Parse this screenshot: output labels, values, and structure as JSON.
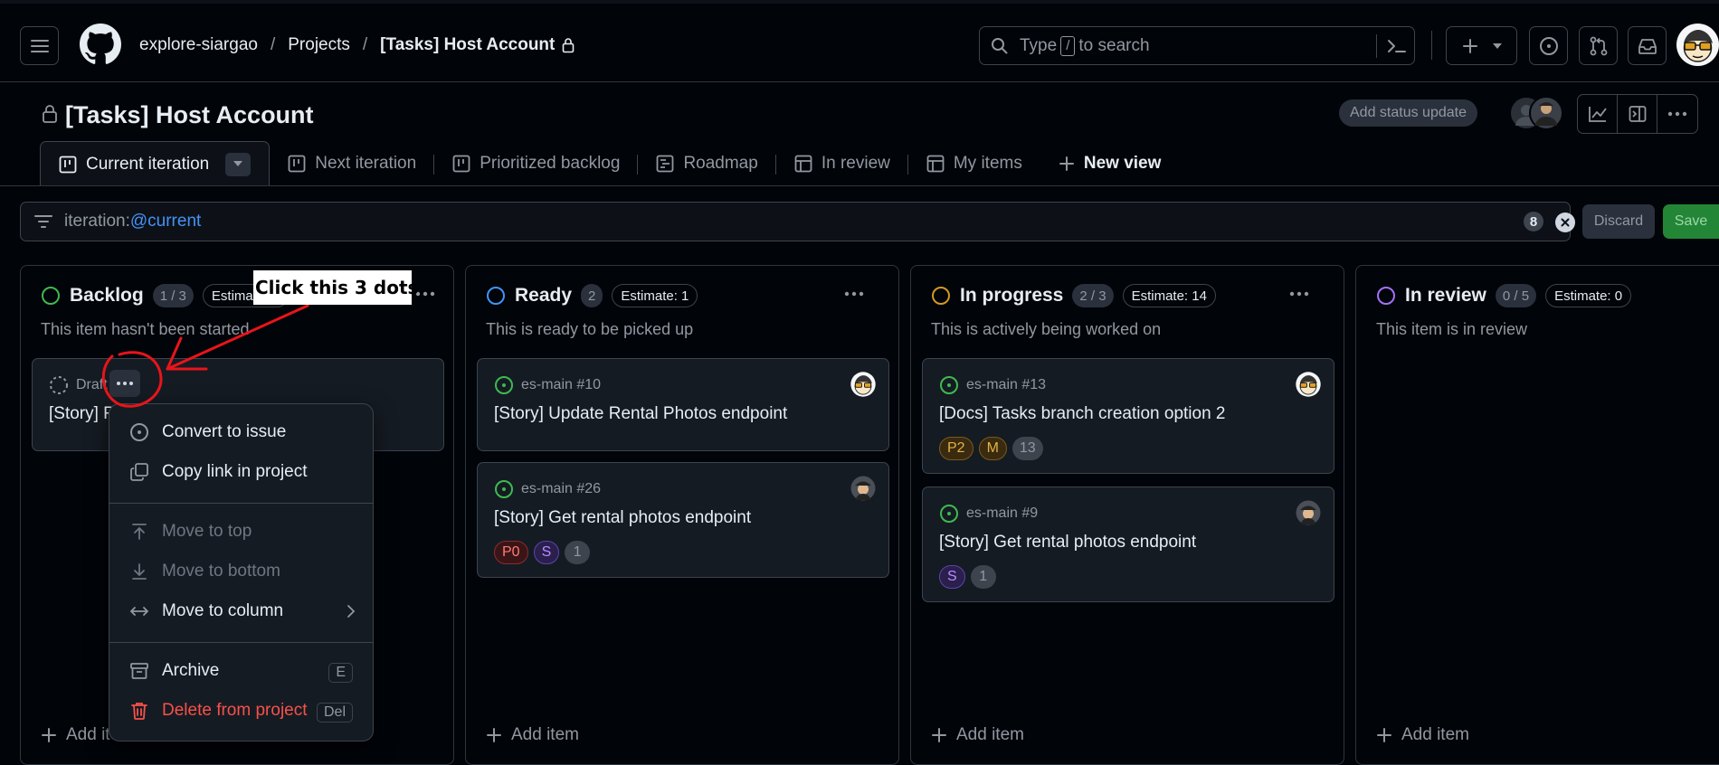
{
  "header": {
    "org": "explore-siargao",
    "projects": "Projects",
    "project": "[Tasks] Host Account",
    "search_prefix": "Type",
    "search_key": "/",
    "search_suffix": "to search"
  },
  "project": {
    "title": "[Tasks] Host Account",
    "status_update": "Add status update"
  },
  "tabs": [
    {
      "label": "Current iteration",
      "icon": "board-icon"
    },
    {
      "label": "Next iteration",
      "icon": "board-icon"
    },
    {
      "label": "Prioritized backlog",
      "icon": "board-icon"
    },
    {
      "label": "Roadmap",
      "icon": "roadmap-icon"
    },
    {
      "label": "In review",
      "icon": "table-icon"
    },
    {
      "label": "My items",
      "icon": "table-icon"
    },
    {
      "label": "New view",
      "icon": "plus-icon"
    }
  ],
  "filter": {
    "key": "iteration:",
    "value": "@current",
    "count": "8",
    "discard": "Discard",
    "save": "Save"
  },
  "columns": [
    {
      "title": "Backlog",
      "count": "1 / 3",
      "estimate": "Estimate: 0",
      "description": "This item hasn't been started",
      "status_color": "#3fb950",
      "add_item": "Add item",
      "cards": [
        {
          "type": "draft",
          "meta": "Draft",
          "title": "[Story] Rental Photos"
        }
      ]
    },
    {
      "title": "Ready",
      "count": "2",
      "estimate": "Estimate: 1",
      "description": "This is ready to be picked up",
      "status_color": "#4493f8",
      "add_item": "Add item",
      "cards": [
        {
          "meta": "es-main #10",
          "title": "[Story] Update Rental Photos endpoint",
          "labels": []
        },
        {
          "meta": "es-main #26",
          "title": "[Story] Get rental photos endpoint",
          "labels": [
            "P0",
            "S",
            "1"
          ]
        }
      ]
    },
    {
      "title": "In progress",
      "count": "2 / 3",
      "estimate": "Estimate: 14",
      "description": "This is actively being worked on",
      "status_color": "#d29922",
      "add_item": "Add item",
      "cards": [
        {
          "meta": "es-main #13",
          "title": "[Docs] Tasks branch creation option 2",
          "labels": [
            "P2",
            "M",
            "13"
          ]
        },
        {
          "meta": "es-main #9",
          "title": "[Story] Get rental photos endpoint",
          "labels": [
            "S",
            "1"
          ]
        }
      ]
    },
    {
      "title": "In review",
      "count": "0 / 5",
      "estimate": "Estimate: 0",
      "description": "This item is in review",
      "status_color": "#a371f7",
      "add_item": "Add item",
      "cards": []
    }
  ],
  "context_menu": {
    "items": [
      {
        "label": "Convert to issue",
        "icon": "issue-opened-icon"
      },
      {
        "label": "Copy link in project",
        "icon": "copy-icon"
      },
      {
        "label": "Move to top",
        "icon": "arrow-up-to-top-icon",
        "disabled": true
      },
      {
        "label": "Move to bottom",
        "icon": "arrow-down-to-bottom-icon",
        "disabled": true
      },
      {
        "label": "Move to column",
        "icon": "arrow-both-icon"
      },
      {
        "label": "Archive",
        "icon": "archive-icon",
        "shortcut": "E"
      },
      {
        "label": "Delete from project",
        "icon": "trash-icon",
        "shortcut": "Del"
      }
    ]
  },
  "annotation": {
    "text": "Click this 3 dots.",
    "color": "#e8141b"
  },
  "colors": {
    "background": "#010409",
    "card": "#151b23",
    "border": "#3d444d",
    "accent_link": "#4493f8",
    "save_green": "#238636",
    "danger": "#f85149"
  }
}
